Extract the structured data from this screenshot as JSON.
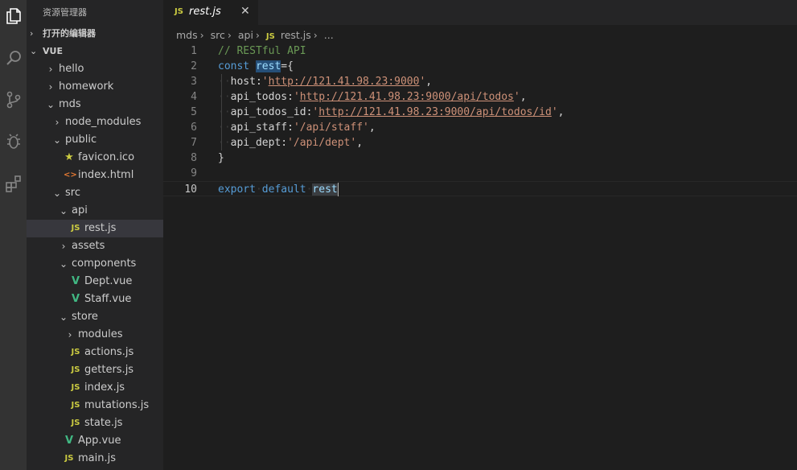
{
  "sidebar": {
    "title": "资源管理器",
    "open_editors": "打开的编辑器",
    "workspace": "VUE",
    "items": [
      {
        "label": "hello",
        "depth": 1,
        "kind": "folder",
        "open": false
      },
      {
        "label": "homework",
        "depth": 1,
        "kind": "folder",
        "open": false
      },
      {
        "label": "mds",
        "depth": 1,
        "kind": "folder",
        "open": true
      },
      {
        "label": "node_modules",
        "depth": 2,
        "kind": "folder",
        "open": false
      },
      {
        "label": "public",
        "depth": 2,
        "kind": "folder",
        "open": true
      },
      {
        "label": "favicon.ico",
        "depth": 3,
        "kind": "ico"
      },
      {
        "label": "index.html",
        "depth": 3,
        "kind": "html"
      },
      {
        "label": "src",
        "depth": 2,
        "kind": "folder",
        "open": true
      },
      {
        "label": "api",
        "depth": 3,
        "kind": "folder",
        "open": true
      },
      {
        "label": "rest.js",
        "depth": 4,
        "kind": "js",
        "active": true
      },
      {
        "label": "assets",
        "depth": 3,
        "kind": "folder",
        "open": false
      },
      {
        "label": "components",
        "depth": 3,
        "kind": "folder",
        "open": true
      },
      {
        "label": "Dept.vue",
        "depth": 4,
        "kind": "vue"
      },
      {
        "label": "Staff.vue",
        "depth": 4,
        "kind": "vue"
      },
      {
        "label": "store",
        "depth": 3,
        "kind": "folder",
        "open": true
      },
      {
        "label": "modules",
        "depth": 4,
        "kind": "folder",
        "open": false
      },
      {
        "label": "actions.js",
        "depth": 4,
        "kind": "js"
      },
      {
        "label": "getters.js",
        "depth": 4,
        "kind": "js"
      },
      {
        "label": "index.js",
        "depth": 4,
        "kind": "js"
      },
      {
        "label": "mutations.js",
        "depth": 4,
        "kind": "js"
      },
      {
        "label": "state.js",
        "depth": 4,
        "kind": "js"
      },
      {
        "label": "App.vue",
        "depth": 3,
        "kind": "vue"
      },
      {
        "label": "main.js",
        "depth": 3,
        "kind": "js"
      }
    ]
  },
  "tab": {
    "icon": "JS",
    "name": "rest.js",
    "close": "✕"
  },
  "breadcrumb": {
    "parts": [
      "mds",
      "src",
      "api"
    ],
    "file_icon": "JS",
    "file": "rest.js",
    "more": "..."
  },
  "editor": {
    "current_line": 10,
    "lines": [
      {
        "n": "1",
        "tokens": [
          {
            "t": "// RESTful API",
            "c": "cm"
          }
        ]
      },
      {
        "n": "2",
        "tokens": [
          {
            "t": "const",
            "c": "kw"
          },
          {
            "t": " ",
            "c": "pn"
          },
          {
            "t": "rest",
            "c": "vr hl"
          },
          {
            "t": "={",
            "c": "pn"
          }
        ]
      },
      {
        "n": "3",
        "tokens": [
          {
            "t": "··",
            "c": "ws"
          },
          {
            "t": "host:",
            "c": "pr"
          },
          {
            "t": "'",
            "c": "st"
          },
          {
            "t": "http://121.41.98.23:9000",
            "c": "st ul"
          },
          {
            "t": "'",
            "c": "st"
          },
          {
            "t": ",",
            "c": "pn"
          }
        ]
      },
      {
        "n": "4",
        "tokens": [
          {
            "t": "··",
            "c": "ws"
          },
          {
            "t": "api_todos:",
            "c": "pr"
          },
          {
            "t": "'",
            "c": "st"
          },
          {
            "t": "http://121.41.98.23:9000/api/todos",
            "c": "st ul"
          },
          {
            "t": "'",
            "c": "st"
          },
          {
            "t": ",",
            "c": "pn"
          }
        ]
      },
      {
        "n": "5",
        "tokens": [
          {
            "t": "··",
            "c": "ws"
          },
          {
            "t": "api_todos_id:",
            "c": "pr"
          },
          {
            "t": "'",
            "c": "st"
          },
          {
            "t": "http://121.41.98.23:9000/api/todos/id",
            "c": "st ul"
          },
          {
            "t": "'",
            "c": "st"
          },
          {
            "t": ",",
            "c": "pn"
          }
        ]
      },
      {
        "n": "6",
        "tokens": [
          {
            "t": "··",
            "c": "ws"
          },
          {
            "t": "api_staff:",
            "c": "pr"
          },
          {
            "t": "'/api/staff'",
            "c": "st"
          },
          {
            "t": ",",
            "c": "pn"
          }
        ]
      },
      {
        "n": "7",
        "tokens": [
          {
            "t": "··",
            "c": "ws"
          },
          {
            "t": "api_dept:",
            "c": "pr"
          },
          {
            "t": "'/api/dept'",
            "c": "st"
          },
          {
            "t": ",",
            "c": "pn"
          }
        ]
      },
      {
        "n": "8",
        "tokens": [
          {
            "t": "}",
            "c": "pn"
          }
        ]
      },
      {
        "n": "9",
        "tokens": []
      },
      {
        "n": "10",
        "tokens": [
          {
            "t": "export",
            "c": "kw"
          },
          {
            "t": "·",
            "c": "ws"
          },
          {
            "t": "default",
            "c": "kw"
          },
          {
            "t": "·",
            "c": "ws"
          },
          {
            "t": "rest",
            "c": "vr hl2"
          }
        ]
      }
    ]
  },
  "activity": [
    "files-icon",
    "search-icon",
    "source-control-icon",
    "debug-icon",
    "extensions-icon"
  ],
  "colors": {
    "editor_bg": "#1e1e1e",
    "sidebar_bg": "#252526",
    "activity_bg": "#333333",
    "js_icon": "#cbcb41",
    "vue_icon": "#41b883",
    "html_icon": "#e37933"
  }
}
